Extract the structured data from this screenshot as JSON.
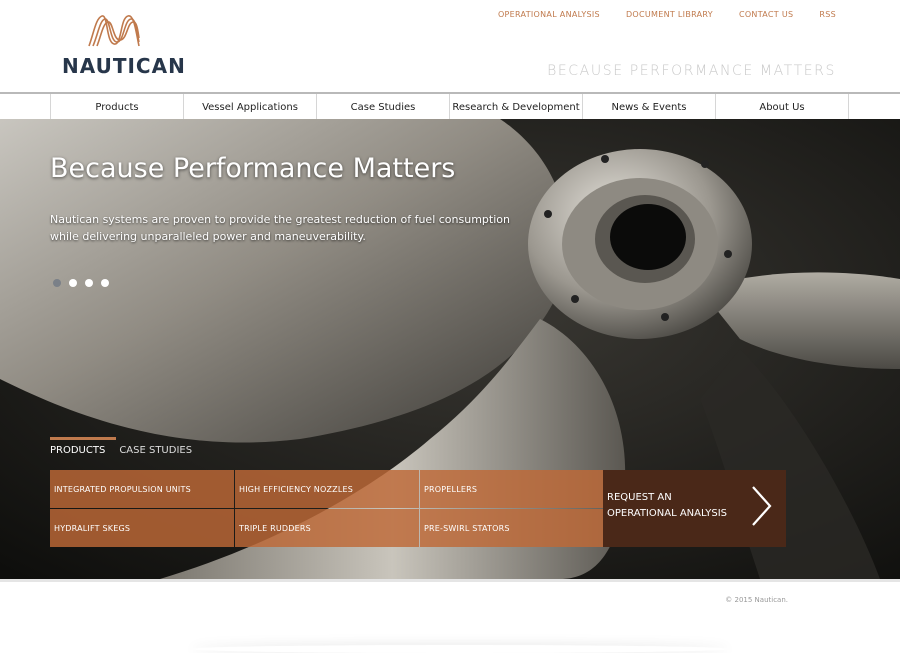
{
  "brand": {
    "name": "NAUTICAN",
    "accent": "#c07a4d"
  },
  "top_links": [
    "OPERATIONAL ANALYSIS",
    "DOCUMENT LIBRARY",
    "CONTACT US",
    "RSS"
  ],
  "tagline": "BECAUSE PERFORMANCE MATTERS",
  "nav": [
    "Products",
    "Vessel Applications",
    "Case Studies",
    "Research & Development",
    "News & Events",
    "About Us"
  ],
  "hero": {
    "title": "Because Performance Matters",
    "body": "Nautican systems are proven to provide the greatest reduction of fuel consumption while delivering unparalleled power and maneuverability.",
    "slide_count": 4,
    "active_slide": 1
  },
  "tabs": [
    {
      "label": "PRODUCTS",
      "active": true
    },
    {
      "label": "CASE STUDIES",
      "active": false
    }
  ],
  "product_links": [
    "INTEGRATED PROPULSION UNITS",
    "HIGH EFFICIENCY NOZZLES",
    "PROPELLERS",
    "HYDRALIFT SKEGS",
    "TRIPLE RUDDERS",
    "PRE-SWIRL STATORS"
  ],
  "cta": {
    "label": "REQUEST AN OPERATIONAL ANALYSIS",
    "icon": "chevron-right-icon"
  },
  "footer": {
    "copyright": "© 2015 Nautican."
  }
}
